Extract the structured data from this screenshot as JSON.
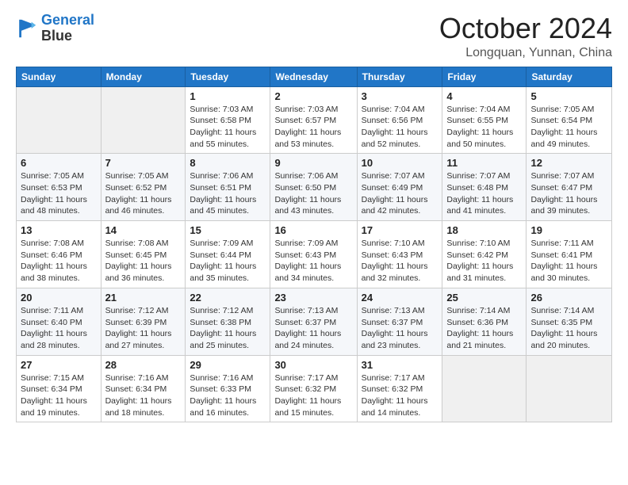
{
  "logo": {
    "line1": "General",
    "line2": "Blue"
  },
  "title": "October 2024",
  "location": "Longquan, Yunnan, China",
  "days_of_week": [
    "Sunday",
    "Monday",
    "Tuesday",
    "Wednesday",
    "Thursday",
    "Friday",
    "Saturday"
  ],
  "weeks": [
    [
      {
        "day": "",
        "info": ""
      },
      {
        "day": "",
        "info": ""
      },
      {
        "day": "1",
        "info": "Sunrise: 7:03 AM\nSunset: 6:58 PM\nDaylight: 11 hours and 55 minutes."
      },
      {
        "day": "2",
        "info": "Sunrise: 7:03 AM\nSunset: 6:57 PM\nDaylight: 11 hours and 53 minutes."
      },
      {
        "day": "3",
        "info": "Sunrise: 7:04 AM\nSunset: 6:56 PM\nDaylight: 11 hours and 52 minutes."
      },
      {
        "day": "4",
        "info": "Sunrise: 7:04 AM\nSunset: 6:55 PM\nDaylight: 11 hours and 50 minutes."
      },
      {
        "day": "5",
        "info": "Sunrise: 7:05 AM\nSunset: 6:54 PM\nDaylight: 11 hours and 49 minutes."
      }
    ],
    [
      {
        "day": "6",
        "info": "Sunrise: 7:05 AM\nSunset: 6:53 PM\nDaylight: 11 hours and 48 minutes."
      },
      {
        "day": "7",
        "info": "Sunrise: 7:05 AM\nSunset: 6:52 PM\nDaylight: 11 hours and 46 minutes."
      },
      {
        "day": "8",
        "info": "Sunrise: 7:06 AM\nSunset: 6:51 PM\nDaylight: 11 hours and 45 minutes."
      },
      {
        "day": "9",
        "info": "Sunrise: 7:06 AM\nSunset: 6:50 PM\nDaylight: 11 hours and 43 minutes."
      },
      {
        "day": "10",
        "info": "Sunrise: 7:07 AM\nSunset: 6:49 PM\nDaylight: 11 hours and 42 minutes."
      },
      {
        "day": "11",
        "info": "Sunrise: 7:07 AM\nSunset: 6:48 PM\nDaylight: 11 hours and 41 minutes."
      },
      {
        "day": "12",
        "info": "Sunrise: 7:07 AM\nSunset: 6:47 PM\nDaylight: 11 hours and 39 minutes."
      }
    ],
    [
      {
        "day": "13",
        "info": "Sunrise: 7:08 AM\nSunset: 6:46 PM\nDaylight: 11 hours and 38 minutes."
      },
      {
        "day": "14",
        "info": "Sunrise: 7:08 AM\nSunset: 6:45 PM\nDaylight: 11 hours and 36 minutes."
      },
      {
        "day": "15",
        "info": "Sunrise: 7:09 AM\nSunset: 6:44 PM\nDaylight: 11 hours and 35 minutes."
      },
      {
        "day": "16",
        "info": "Sunrise: 7:09 AM\nSunset: 6:43 PM\nDaylight: 11 hours and 34 minutes."
      },
      {
        "day": "17",
        "info": "Sunrise: 7:10 AM\nSunset: 6:43 PM\nDaylight: 11 hours and 32 minutes."
      },
      {
        "day": "18",
        "info": "Sunrise: 7:10 AM\nSunset: 6:42 PM\nDaylight: 11 hours and 31 minutes."
      },
      {
        "day": "19",
        "info": "Sunrise: 7:11 AM\nSunset: 6:41 PM\nDaylight: 11 hours and 30 minutes."
      }
    ],
    [
      {
        "day": "20",
        "info": "Sunrise: 7:11 AM\nSunset: 6:40 PM\nDaylight: 11 hours and 28 minutes."
      },
      {
        "day": "21",
        "info": "Sunrise: 7:12 AM\nSunset: 6:39 PM\nDaylight: 11 hours and 27 minutes."
      },
      {
        "day": "22",
        "info": "Sunrise: 7:12 AM\nSunset: 6:38 PM\nDaylight: 11 hours and 25 minutes."
      },
      {
        "day": "23",
        "info": "Sunrise: 7:13 AM\nSunset: 6:37 PM\nDaylight: 11 hours and 24 minutes."
      },
      {
        "day": "24",
        "info": "Sunrise: 7:13 AM\nSunset: 6:37 PM\nDaylight: 11 hours and 23 minutes."
      },
      {
        "day": "25",
        "info": "Sunrise: 7:14 AM\nSunset: 6:36 PM\nDaylight: 11 hours and 21 minutes."
      },
      {
        "day": "26",
        "info": "Sunrise: 7:14 AM\nSunset: 6:35 PM\nDaylight: 11 hours and 20 minutes."
      }
    ],
    [
      {
        "day": "27",
        "info": "Sunrise: 7:15 AM\nSunset: 6:34 PM\nDaylight: 11 hours and 19 minutes."
      },
      {
        "day": "28",
        "info": "Sunrise: 7:16 AM\nSunset: 6:34 PM\nDaylight: 11 hours and 18 minutes."
      },
      {
        "day": "29",
        "info": "Sunrise: 7:16 AM\nSunset: 6:33 PM\nDaylight: 11 hours and 16 minutes."
      },
      {
        "day": "30",
        "info": "Sunrise: 7:17 AM\nSunset: 6:32 PM\nDaylight: 11 hours and 15 minutes."
      },
      {
        "day": "31",
        "info": "Sunrise: 7:17 AM\nSunset: 6:32 PM\nDaylight: 11 hours and 14 minutes."
      },
      {
        "day": "",
        "info": ""
      },
      {
        "day": "",
        "info": ""
      }
    ]
  ]
}
